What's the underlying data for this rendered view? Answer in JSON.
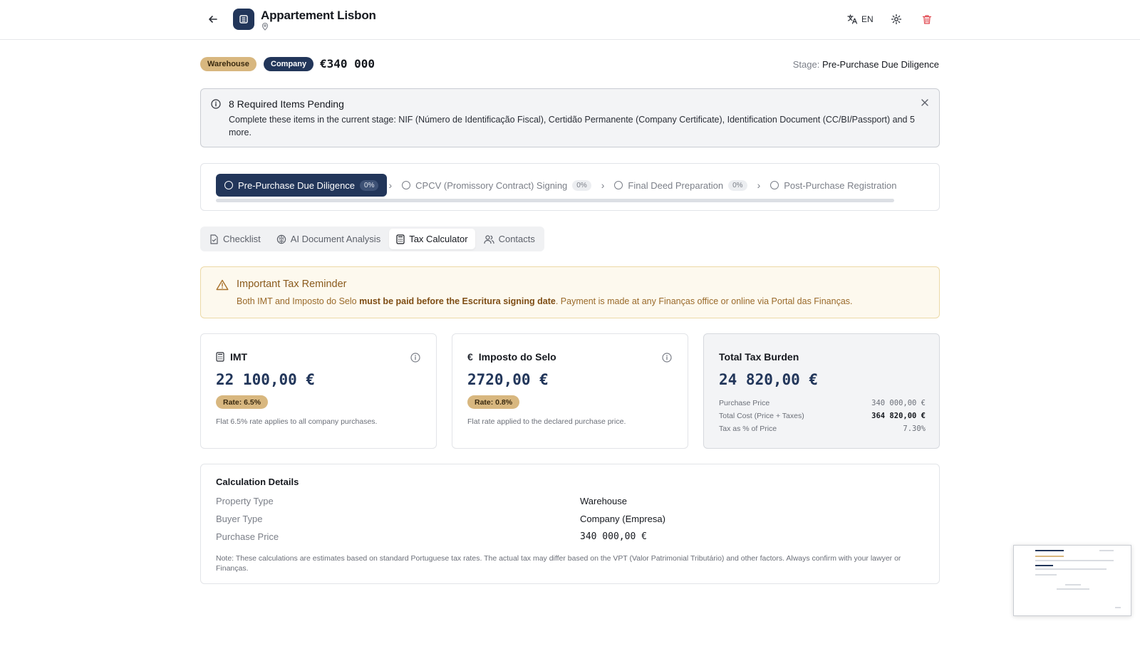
{
  "header": {
    "title": "Appartement Lisbon",
    "language": "EN"
  },
  "summary": {
    "property_badge": "Warehouse",
    "buyer_badge": "Company",
    "price": "€340 000",
    "stage_label": "Stage:",
    "stage_value": "Pre-Purchase Due Diligence"
  },
  "alert": {
    "title": "8 Required Items Pending",
    "body": "Complete these items in the current stage: NIF (Número de Identificação Fiscal), Certidão Permanente (Company Certificate), Identification Document (CC/BI/Passport) and 5 more."
  },
  "stepper": {
    "steps": [
      {
        "label": "Pre-Purchase Due Diligence",
        "pct": "0%",
        "active": true
      },
      {
        "label": "CPCV (Promissory Contract) Signing",
        "pct": "0%",
        "active": false
      },
      {
        "label": "Final Deed Preparation",
        "pct": "0%",
        "active": false
      },
      {
        "label": "Post-Purchase Registration",
        "pct": "",
        "active": false
      }
    ]
  },
  "tabs": [
    {
      "label": "Checklist",
      "icon": "file-check-icon"
    },
    {
      "label": "AI Document Analysis",
      "icon": "brain-icon"
    },
    {
      "label": "Tax Calculator",
      "icon": "calculator-icon"
    },
    {
      "label": "Contacts",
      "icon": "users-icon"
    }
  ],
  "reminder": {
    "title": "Important Tax Reminder",
    "body_pre": "Both IMT and Imposto do Selo ",
    "body_bold": "must be paid before the Escritura signing date",
    "body_post": ". Payment is made at any Finanças office or online via Portal das Finanças."
  },
  "cards": {
    "imt": {
      "title": "IMT",
      "amount": "22 100,00 €",
      "rate": "Rate: 6.5%",
      "note": "Flat 6.5% rate applies to all company purchases."
    },
    "selo": {
      "title": "Imposto do Selo",
      "amount": "2720,00 €",
      "rate": "Rate: 0.8%",
      "note": "Flat rate applied to the declared purchase price."
    },
    "total": {
      "title": "Total Tax Burden",
      "amount": "24 820,00 €",
      "rows": [
        {
          "label": "Purchase Price",
          "value": "340 000,00 €"
        },
        {
          "label": "Total Cost (Price + Taxes)",
          "value": "364 820,00 €"
        },
        {
          "label": "Tax as % of Price",
          "value": "7.30%"
        }
      ]
    }
  },
  "details": {
    "title": "Calculation Details",
    "rows": [
      {
        "label": "Property Type",
        "value": "Warehouse"
      },
      {
        "label": "Buyer Type",
        "value": "Company (Empresa)"
      },
      {
        "label": "Purchase Price",
        "value": "340 000,00 €"
      }
    ],
    "note": "Note: These calculations are estimates based on standard Portuguese tax rates. The actual tax may differ based on the VPT (Valor Patrimonial Tributário) and other factors. Always confirm with your lawyer or Finanças."
  },
  "colors": {
    "brand": "#22365a",
    "gold": "#d8b77f",
    "danger": "#e0464e",
    "warning_text": "#8a5a1d"
  }
}
